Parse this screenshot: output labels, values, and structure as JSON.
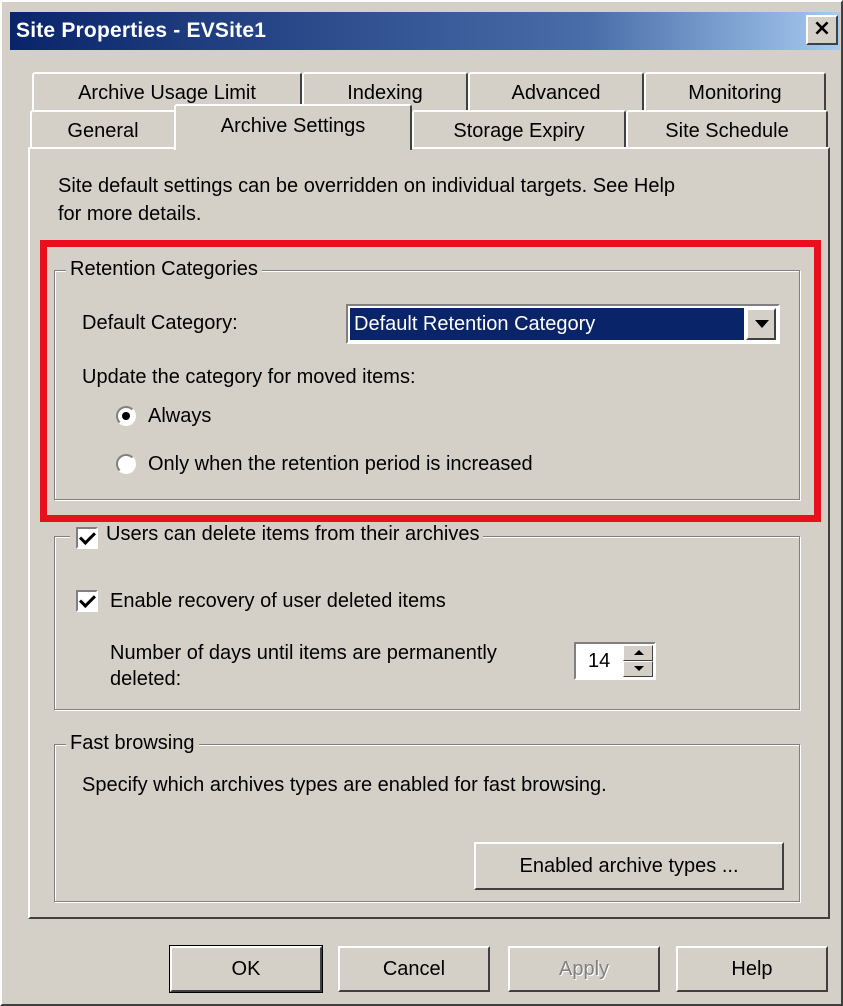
{
  "window": {
    "title": "Site Properties - EVSite1",
    "close_glyph": "×"
  },
  "tabs": {
    "row_back": [
      {
        "label": "Archive Usage Limit"
      },
      {
        "label": "Indexing"
      },
      {
        "label": "Advanced"
      },
      {
        "label": "Monitoring"
      }
    ],
    "row_front": [
      {
        "label": "General"
      },
      {
        "label": "Archive Settings",
        "active": true
      },
      {
        "label": "Storage Expiry"
      },
      {
        "label": "Site Schedule"
      }
    ]
  },
  "intro": {
    "line1": "Site default settings can be overridden on individual targets. See Help",
    "line2": "for more details."
  },
  "retention": {
    "legend": "Retention Categories",
    "default_category_label": "Default Category:",
    "default_category_value": "Default Retention Category",
    "update_label": "Update the category for moved items:",
    "options": [
      {
        "label": "Always",
        "selected": true
      },
      {
        "label": "Only when the retention period is increased",
        "selected": false
      }
    ]
  },
  "deletion": {
    "users_delete_label": "Users can delete items from their archives",
    "users_delete_checked": true,
    "enable_recovery_label": "Enable recovery of user deleted items",
    "enable_recovery_checked": true,
    "days_label_line1": "Number of days until items are permanently",
    "days_label_line2": "deleted:",
    "days_value": "14"
  },
  "fast_browsing": {
    "legend": "Fast browsing",
    "description": "Specify which archives types are enabled for fast browsing.",
    "button_label": "Enabled archive types ..."
  },
  "footer": {
    "ok": "OK",
    "cancel": "Cancel",
    "apply": "Apply",
    "help": "Help"
  },
  "colors": {
    "highlight": "#e8101c",
    "title_bar": "#0a246a",
    "dialog_face": "#d4d0c8"
  }
}
